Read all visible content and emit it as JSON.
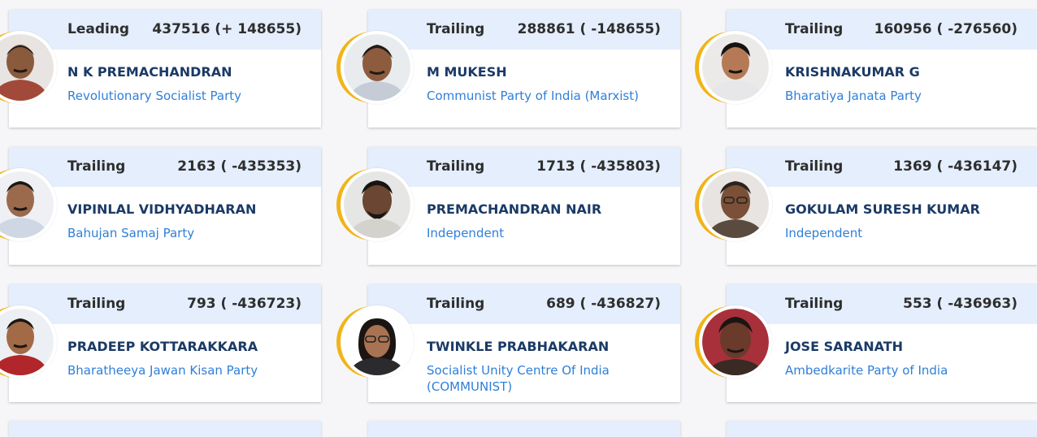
{
  "candidates": [
    {
      "status": "Leading",
      "votes": "437516 (+ 148655)",
      "name": "N K PREMACHANDRAN",
      "party": "Revolutionary Socialist Party",
      "photo": "candidate-photo-icon"
    },
    {
      "status": "Trailing",
      "votes": "288861 ( -148655)",
      "name": "M MUKESH",
      "party": "Communist Party of India (Marxist)",
      "photo": "candidate-photo-icon"
    },
    {
      "status": "Trailing",
      "votes": "160956 ( -276560)",
      "name": "KRISHNAKUMAR G",
      "party": "Bharatiya Janata Party",
      "photo": "candidate-photo-icon"
    },
    {
      "status": "Trailing",
      "votes": "2163 ( -435353)",
      "name": "VIPINLAL VIDHYADHARAN",
      "party": "Bahujan Samaj Party",
      "photo": "candidate-photo-icon"
    },
    {
      "status": "Trailing",
      "votes": "1713 ( -435803)",
      "name": "PREMACHANDRAN NAIR",
      "party": "Independent",
      "photo": "candidate-photo-icon"
    },
    {
      "status": "Trailing",
      "votes": "1369 ( -436147)",
      "name": "GOKULAM SURESH KUMAR",
      "party": "Independent",
      "photo": "candidate-photo-icon"
    },
    {
      "status": "Trailing",
      "votes": "793 ( -436723)",
      "name": "PRADEEP KOTTARAKKARA",
      "party": "Bharatheeya Jawan Kisan Party",
      "photo": "candidate-photo-icon"
    },
    {
      "status": "Trailing",
      "votes": "689 ( -436827)",
      "name": "TWINKLE PRABHAKARAN",
      "party": "Socialist Unity Centre Of India (COMMUNIST)",
      "photo": "candidate-photo-icon"
    },
    {
      "status": "Trailing",
      "votes": "553 ( -436963)",
      "name": "JOSE SARANATH",
      "party": "Ambedkarite Party of India",
      "photo": "candidate-photo-icon"
    }
  ],
  "colors": {
    "header_bg": "#e4eefc",
    "name": "#1b3a66",
    "party": "#2f7fd8",
    "ring": "#f1b418"
  }
}
